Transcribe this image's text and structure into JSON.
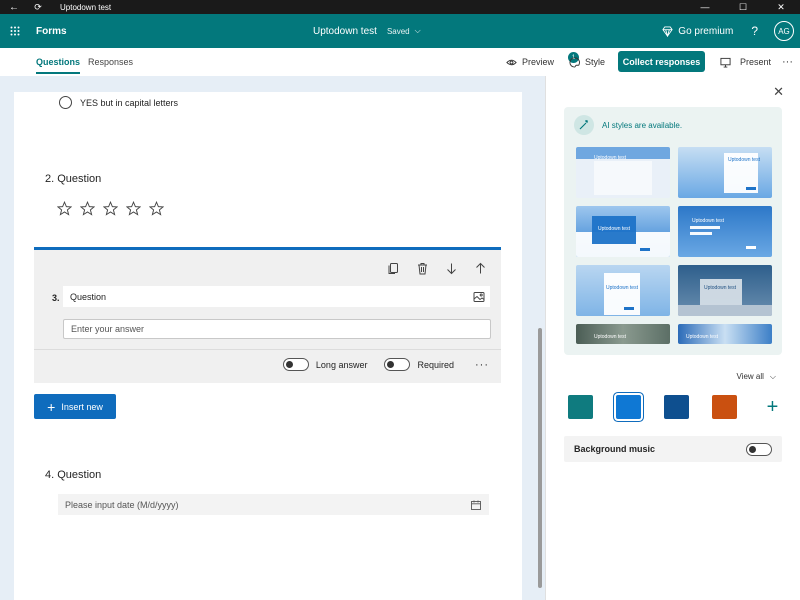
{
  "titlebar": {
    "title": "Uptodown test"
  },
  "appbar": {
    "app_name": "Forms",
    "doc_title": "Uptodown test",
    "save_status": "Saved",
    "go_premium": "Go premium",
    "avatar_initials": "AG"
  },
  "cmdbar": {
    "tabs": [
      {
        "label": "Questions",
        "active": true
      },
      {
        "label": "Responses",
        "active": false
      }
    ],
    "preview": "Preview",
    "style": "Style",
    "style_badge": "1",
    "collect": "Collect responses",
    "present": "Present"
  },
  "form": {
    "option_text": "YES but in capital letters",
    "q2_title": "2. Question",
    "q2_rating": 5,
    "q3_number": "3.",
    "q3_title": "Question",
    "q3_placeholder": "Enter your answer",
    "q3_long_answer": "Long answer",
    "q3_required": "Required",
    "insert_new": "Insert new",
    "q4_title": "4. Question",
    "q4_placeholder": "Please input date (M/d/yyyy)"
  },
  "panel": {
    "ai_text": "AI styles are available.",
    "thumb_label": "Uptodown test",
    "view_all": "View all",
    "colors": [
      "#0f7b7f",
      "#0f78d4",
      "#0e4f8f",
      "#ca5010"
    ],
    "selected_color": 1,
    "background_music": "Background music"
  },
  "accent": "#03787c"
}
